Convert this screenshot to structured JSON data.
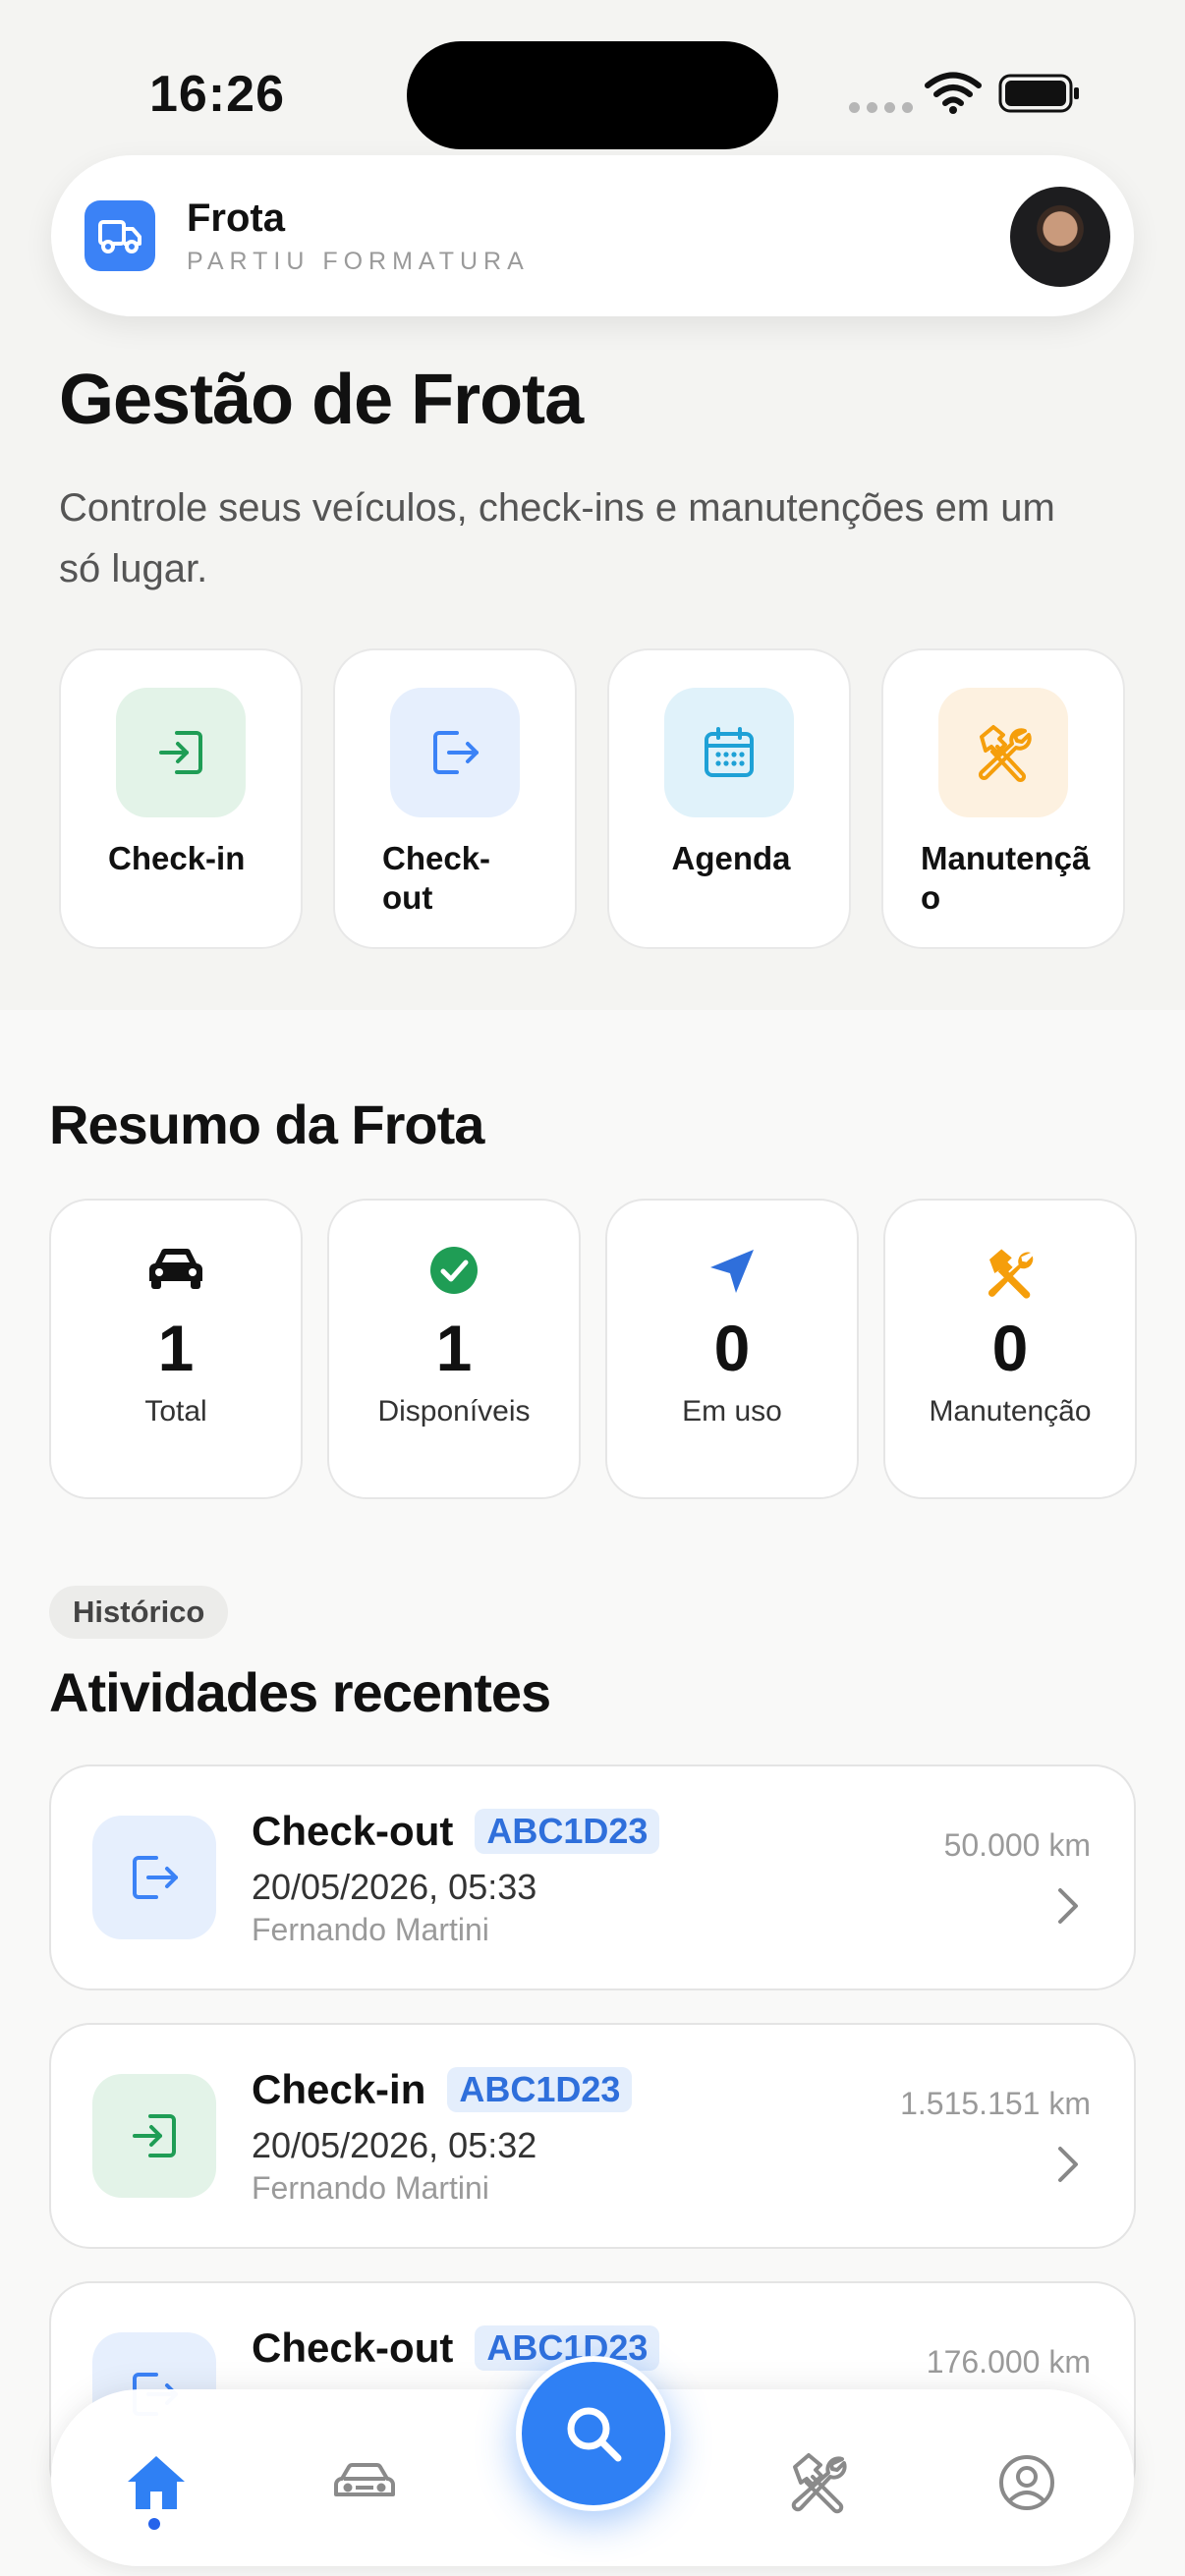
{
  "status_bar": {
    "time": "16:26"
  },
  "header": {
    "app_name": "Frota",
    "subtitle": "PARTIU FORMATURA"
  },
  "page": {
    "title": "Gestão de Frota",
    "description": "Controle seus veículos, check-ins e manutenções em um só lugar."
  },
  "quick_actions": [
    {
      "label": "Check-in",
      "icon": "login-icon",
      "color": "#1f9d55",
      "bg": "#e3f3e8"
    },
    {
      "label": "Check-out",
      "icon": "logout-icon",
      "color": "#3b82f6",
      "bg": "#e6effd"
    },
    {
      "label": "Agenda",
      "icon": "calendar-icon",
      "color": "#1ea1d6",
      "bg": "#e0f2fa"
    },
    {
      "label": "Manutenção",
      "icon": "tools-icon",
      "color": "#f59e0b",
      "bg": "#fdf1e0"
    }
  ],
  "summary": {
    "title": "Resumo da Frota",
    "stats": [
      {
        "value": "1",
        "label": "Total",
        "icon": "car-icon"
      },
      {
        "value": "1",
        "label": "Disponíveis",
        "icon": "check-circle-icon"
      },
      {
        "value": "0",
        "label": "Em uso",
        "icon": "navigation-icon"
      },
      {
        "value": "0",
        "label": "Manutenção",
        "icon": "tools-icon"
      }
    ]
  },
  "history": {
    "chip": "Histórico",
    "title": "Atividades recentes",
    "items": [
      {
        "type": "Check-out",
        "plate": "ABC1D23",
        "date": "20/05/2026, 05:33",
        "person": "Fernando Martini",
        "km": "50.000 km"
      },
      {
        "type": "Check-in",
        "plate": "ABC1D23",
        "date": "20/05/2026, 05:32",
        "person": "Fernando Martini",
        "km": "1.515.151 km"
      },
      {
        "type": "Check-out",
        "plate": "ABC1D23",
        "date": "",
        "person": "",
        "km": "176.000 km"
      }
    ]
  },
  "nav": {
    "items": [
      "home-icon",
      "car-icon",
      "search-icon",
      "tools-icon",
      "profile-icon"
    ],
    "active": "home-icon"
  },
  "colors": {
    "accent": "#2f80f4",
    "green": "#1f9d55",
    "orange": "#f59e0b",
    "plate_text": "#2f6fdb"
  }
}
